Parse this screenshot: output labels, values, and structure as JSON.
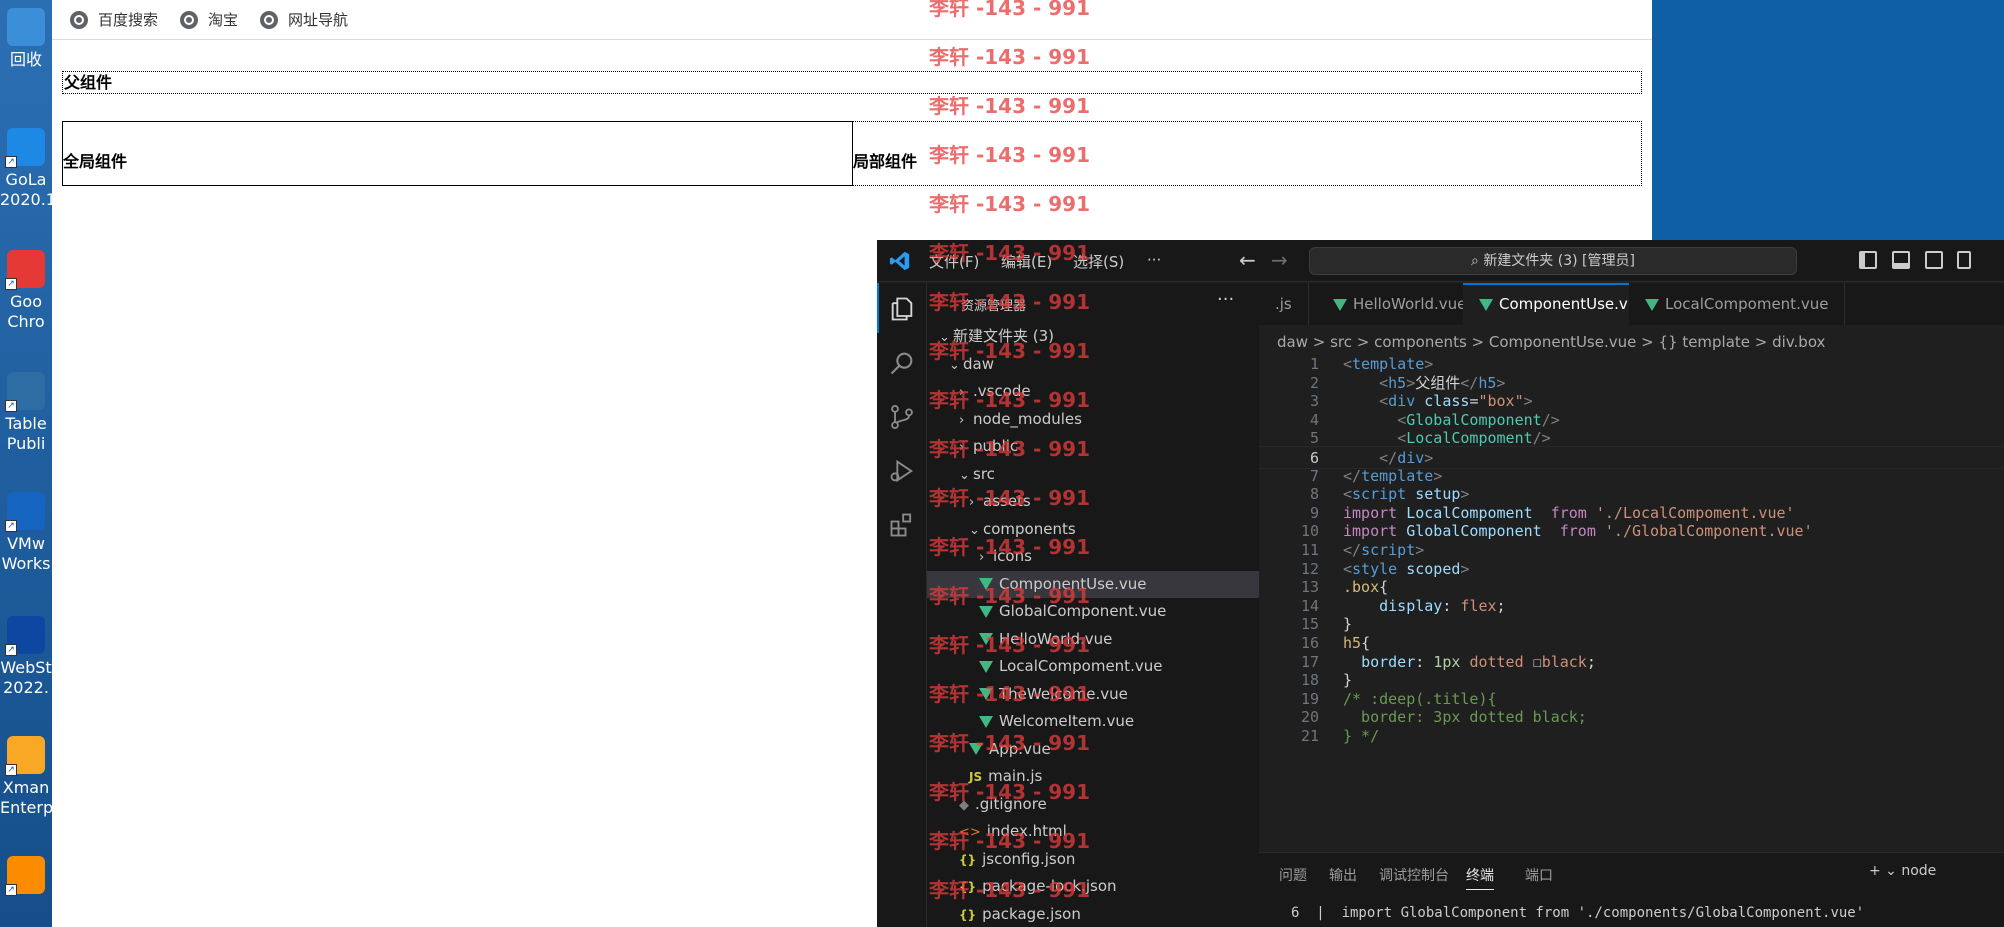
{
  "desktop": {
    "icons": [
      {
        "label": "回收",
        "color": "#3b8ed8"
      },
      {
        "label": "GoLa\n2020.1",
        "color": "#1e88e5"
      },
      {
        "label": "Goo\nChro",
        "color": "#e53935"
      },
      {
        "label": "Table\nPubli",
        "color": "#2e6da4"
      },
      {
        "label": "VMw\nWorks",
        "color": "#1565c0"
      },
      {
        "label": "WebSt\n2022.",
        "color": "#0d47a1"
      },
      {
        "label": "Xman\nEnterp",
        "color": "#f9a825"
      },
      {
        "label": "",
        "color": "#fb8c00"
      }
    ]
  },
  "browser": {
    "bookmarks": [
      "百度搜索",
      "淘宝",
      "网址导航"
    ],
    "parent_heading": "父组件",
    "global_component": "全局组件",
    "local_component": "局部组件"
  },
  "vscode": {
    "menu": [
      "文件(F)",
      "编辑(E)",
      "选择(S)",
      "···"
    ],
    "command_center": "新建文件夹 (3) [管理员]",
    "explorer_title": "资源管理器",
    "explorer_more": "···",
    "tree": [
      {
        "label": "新建文件夹 (3)",
        "type": "folder-open",
        "indent": 0
      },
      {
        "label": "daw",
        "type": "folder-open",
        "indent": 1
      },
      {
        "label": ".vscode",
        "type": "folder",
        "indent": 2
      },
      {
        "label": "node_modules",
        "type": "folder",
        "indent": 2
      },
      {
        "label": "public",
        "type": "folder",
        "indent": 2
      },
      {
        "label": "src",
        "type": "folder-open",
        "indent": 2
      },
      {
        "label": "assets",
        "type": "folder",
        "indent": 3
      },
      {
        "label": "components",
        "type": "folder-open",
        "indent": 3
      },
      {
        "label": "icons",
        "type": "folder",
        "indent": 4
      },
      {
        "label": "ComponentUse.vue",
        "type": "vue",
        "indent": 4,
        "selected": true
      },
      {
        "label": "GlobalComponent.vue",
        "type": "vue",
        "indent": 4
      },
      {
        "label": "HelloWorld.vue",
        "type": "vue",
        "indent": 4
      },
      {
        "label": "LocalCompoment.vue",
        "type": "vue",
        "indent": 4
      },
      {
        "label": "TheWelcome.vue",
        "type": "vue",
        "indent": 4
      },
      {
        "label": "WelcomeItem.vue",
        "type": "vue",
        "indent": 4
      },
      {
        "label": "App.vue",
        "type": "vue",
        "indent": 3
      },
      {
        "label": "main.js",
        "type": "js",
        "indent": 3
      },
      {
        "label": ".gitignore",
        "type": "git",
        "indent": 2
      },
      {
        "label": "index.html",
        "type": "html",
        "indent": 2
      },
      {
        "label": "jsconfig.json",
        "type": "json",
        "indent": 2
      },
      {
        "label": "package-lock.json",
        "type": "json",
        "indent": 2
      },
      {
        "label": "package.json",
        "type": "json",
        "indent": 2
      }
    ],
    "tabs": [
      {
        "label": ".js",
        "vue": false,
        "active": false
      },
      {
        "label": "HelloWorld.vue",
        "vue": true,
        "active": false
      },
      {
        "label": "ComponentUse.vue",
        "vue": true,
        "active": true
      },
      {
        "label": "LocalCompoment.vue",
        "vue": true,
        "active": false
      }
    ],
    "breadcrumb": "daw > src > components > ComponentUse.vue > {} template > div.box",
    "current_line": 6,
    "code": [
      [
        [
          "t-pn",
          "<"
        ],
        [
          "t-tag",
          "template"
        ],
        [
          "t-pn",
          ">"
        ]
      ],
      [
        [
          "t-plain",
          "    "
        ],
        [
          "t-pn",
          "<"
        ],
        [
          "t-tag",
          "h5"
        ],
        [
          "t-pn",
          ">"
        ],
        [
          "t-plain",
          "父组件"
        ],
        [
          "t-pn",
          "</"
        ],
        [
          "t-tag",
          "h5"
        ],
        [
          "t-pn",
          ">"
        ]
      ],
      [
        [
          "t-plain",
          "    "
        ],
        [
          "t-pn",
          "<"
        ],
        [
          "t-tag",
          "div"
        ],
        [
          "t-plain",
          " "
        ],
        [
          "t-attr",
          "class"
        ],
        [
          "t-plain",
          "="
        ],
        [
          "t-str",
          "\"box\""
        ],
        [
          "t-pn",
          ">"
        ]
      ],
      [
        [
          "t-plain",
          "      "
        ],
        [
          "t-pn",
          "<"
        ],
        [
          "t-comp",
          "GlobalComponent"
        ],
        [
          "t-pn",
          "/>"
        ]
      ],
      [
        [
          "t-plain",
          "      "
        ],
        [
          "t-pn",
          "<"
        ],
        [
          "t-comp",
          "LocalCompoment"
        ],
        [
          "t-pn",
          "/>"
        ]
      ],
      [
        [
          "t-plain",
          "    "
        ],
        [
          "t-pn",
          "</"
        ],
        [
          "t-tag",
          "div"
        ],
        [
          "t-pn",
          ">"
        ]
      ],
      [
        [
          "t-pn",
          "</"
        ],
        [
          "t-tag",
          "template"
        ],
        [
          "t-pn",
          ">"
        ]
      ],
      [
        [
          "t-pn",
          "<"
        ],
        [
          "t-tag",
          "script"
        ],
        [
          "t-plain",
          " "
        ],
        [
          "t-attr",
          "setup"
        ],
        [
          "t-pn",
          ">"
        ]
      ],
      [
        [
          "t-kw",
          "import"
        ],
        [
          "t-plain",
          " "
        ],
        [
          "t-id",
          "LocalCompoment"
        ],
        [
          "t-plain",
          "  "
        ],
        [
          "t-kw",
          "from"
        ],
        [
          "t-plain",
          " "
        ],
        [
          "t-str",
          "'./LocalCompoment.vue'"
        ]
      ],
      [
        [
          "t-kw",
          "import"
        ],
        [
          "t-plain",
          " "
        ],
        [
          "t-id",
          "GlobalComponent"
        ],
        [
          "t-plain",
          "  "
        ],
        [
          "t-kw",
          "from"
        ],
        [
          "t-plain",
          " "
        ],
        [
          "t-str",
          "'./GlobalComponent.vue'"
        ]
      ],
      [
        [
          "t-pn",
          "</"
        ],
        [
          "t-tag",
          "script"
        ],
        [
          "t-pn",
          ">"
        ]
      ],
      [
        [
          "t-pn",
          "<"
        ],
        [
          "t-tag",
          "style"
        ],
        [
          "t-plain",
          " "
        ],
        [
          "t-attr",
          "scoped"
        ],
        [
          "t-pn",
          ">"
        ]
      ],
      [
        [
          "t-sel",
          ".box"
        ],
        [
          "t-plain",
          "{"
        ]
      ],
      [
        [
          "t-plain",
          "    "
        ],
        [
          "t-prop",
          "display"
        ],
        [
          "t-plain",
          ": "
        ],
        [
          "t-val",
          "flex"
        ],
        [
          "t-plain",
          ";"
        ]
      ],
      [
        [
          "t-plain",
          "}"
        ]
      ],
      [
        [
          "t-sel",
          "h5"
        ],
        [
          "t-plain",
          "{"
        ]
      ],
      [
        [
          "t-plain",
          "  "
        ],
        [
          "t-prop",
          "border"
        ],
        [
          "t-plain",
          ": "
        ],
        [
          "t-num",
          "1px"
        ],
        [
          "t-plain",
          " "
        ],
        [
          "t-val",
          "dotted"
        ],
        [
          "t-plain",
          " ☐"
        ],
        [
          "t-val",
          "black"
        ],
        [
          "t-plain",
          ";"
        ]
      ],
      [
        [
          "t-plain",
          "}"
        ]
      ],
      [
        [
          "t-cm",
          "/* :deep(.title){"
        ]
      ],
      [
        [
          "t-cm",
          "  border: 3px dotted black;"
        ]
      ],
      [
        [
          "t-cm",
          "} */"
        ]
      ]
    ],
    "panel_tabs": [
      "问题",
      "输出",
      "调试控制台",
      "终端",
      "端口"
    ],
    "panel_active": "终端",
    "panel_tools": "+ ⌄   node",
    "terminal_line": "6  |  import GlobalComponent from './components/GlobalComponent.vue'"
  },
  "watermark": "李轩 -143 - 991"
}
